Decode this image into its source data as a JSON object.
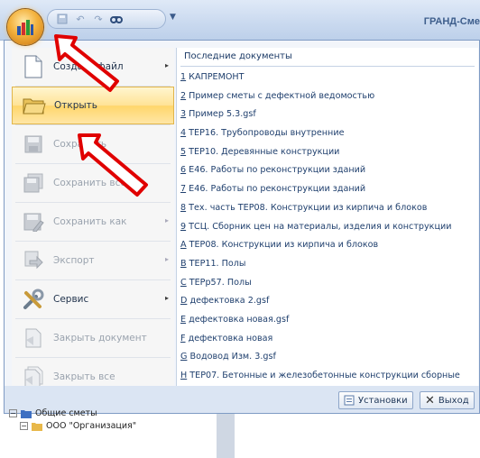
{
  "window": {
    "app_title": "ГРАНД-Сме"
  },
  "qat": {
    "buttons": [
      "save-icon",
      "undo-icon",
      "redo-icon",
      "find-icon"
    ],
    "more": "▼"
  },
  "menu": {
    "commands": [
      {
        "id": "create",
        "label": "Создать файл",
        "icon": "new-file-icon",
        "arrow": "▸",
        "enabled": true
      },
      {
        "id": "open",
        "label": "Открыть",
        "icon": "open-folder-icon",
        "arrow": "",
        "enabled": true,
        "highlighted": true
      },
      {
        "id": "save",
        "label": "Сохранить",
        "icon": "save-icon",
        "arrow": "",
        "enabled": false
      },
      {
        "id": "save-all",
        "label": "Сохранить все",
        "icon": "save-all-icon",
        "arrow": "",
        "enabled": false
      },
      {
        "id": "save-as",
        "label": "Сохранить как",
        "icon": "save-as-icon",
        "arrow": "▸",
        "enabled": false
      },
      {
        "id": "export",
        "label": "Экспорт",
        "icon": "export-icon",
        "arrow": "▸",
        "enabled": false
      },
      {
        "id": "service",
        "label": "Сервис",
        "icon": "tools-icon",
        "arrow": "▸",
        "enabled": true
      },
      {
        "id": "close-doc",
        "label": "Закрыть документ",
        "icon": "close-document-icon",
        "arrow": "",
        "enabled": false
      },
      {
        "id": "close-all",
        "label": "Закрыть все",
        "icon": "close-all-icon",
        "arrow": "",
        "enabled": false
      }
    ],
    "recent": {
      "title": "Последние документы",
      "items": [
        {
          "key": "1",
          "text": " КАПРЕМОНТ"
        },
        {
          "key": "2",
          "text": " Пример сметы с дефектной ведомостью"
        },
        {
          "key": "3",
          "text": " Пример 5.3.gsf"
        },
        {
          "key": "4",
          "text": " ТЕР16. Трубопроводы внутренние"
        },
        {
          "key": "5",
          "text": " ТЕР10. Деревянные конструкции"
        },
        {
          "key": "6",
          "text": " Е46. Работы по реконструкции зданий"
        },
        {
          "key": "7",
          "text": " Е46. Работы по реконструкции зданий"
        },
        {
          "key": "8",
          "text": " Тех. часть ТЕР08. Конструкции из кирпича и блоков"
        },
        {
          "key": "9",
          "text": " ТСЦ. Сборник цен на материалы, изделия и конструкции"
        },
        {
          "key": "A",
          "text": " ТЕР08. Конструкции из кирпича и блоков"
        },
        {
          "key": "B",
          "text": " ТЕР11. Полы"
        },
        {
          "key": "C",
          "text": " ТЕРр57. Полы"
        },
        {
          "key": "D",
          "text": " дефектовка 2.gsf"
        },
        {
          "key": "E",
          "text": " дефектовка новая.gsf"
        },
        {
          "key": "F",
          "text": " дефектовка новая"
        },
        {
          "key": "G",
          "text": " Водовод Изм. 3.gsf"
        },
        {
          "key": "H",
          "text": " ТЕР07. Бетонные и железобетонные конструкции сборные"
        }
      ]
    },
    "buttons": {
      "settings": "Установки",
      "exit": "Выход"
    }
  },
  "tree": {
    "item1": "Общие сметы",
    "item2": "ООО \"Организация\""
  },
  "colors": {
    "accent": "#ffd66b",
    "annotation": "#e00000"
  }
}
